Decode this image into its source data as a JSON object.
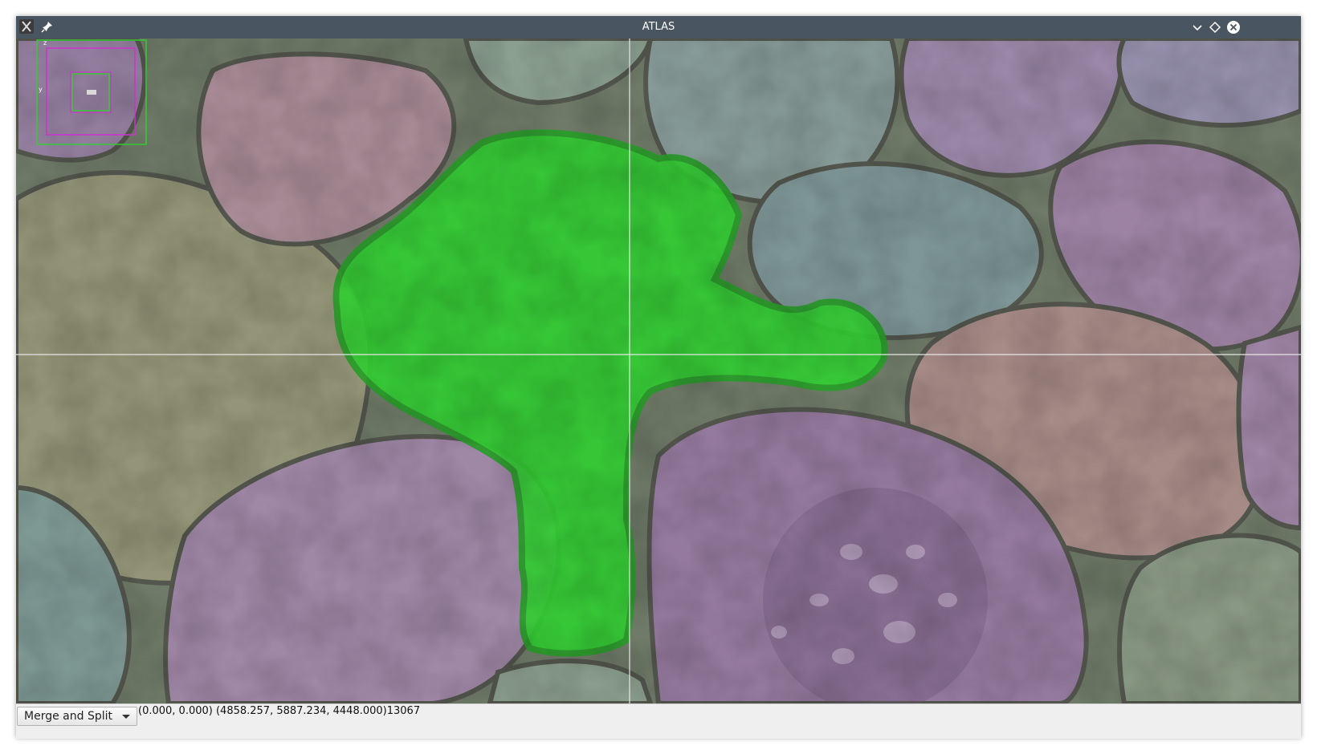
{
  "window": {
    "title": "ATLAS",
    "app_icon": "x-app-icon",
    "buttons": [
      "pin-icon",
      "minimize-icon",
      "maximize-icon",
      "close-icon"
    ]
  },
  "viewer": {
    "content": "segmentation overlay of EM image",
    "highlight_color": "#22e022",
    "crosshair_color": "#e6e6e6",
    "overview": {
      "outer_box_color": "#33cc33",
      "inner_box_color": "#cc33cc",
      "axis_label_y": "y",
      "axis_label_z": "z"
    }
  },
  "status": {
    "mode_select": {
      "selected": "Merge and Split"
    },
    "coordinates": "(0.000, 0.000) (4858.257, 5887.234, 4448.000)13067"
  }
}
